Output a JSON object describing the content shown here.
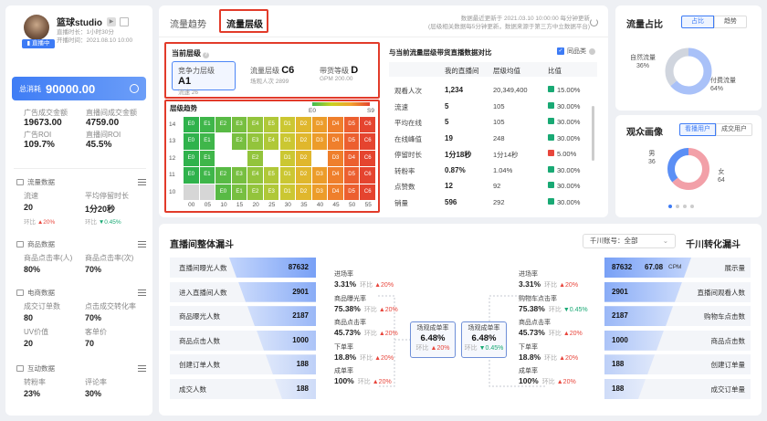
{
  "profile": {
    "name": "篮球studio",
    "live_badge": "直播中",
    "duration_label": "直播时长：",
    "duration_value": "1小时30分",
    "start_label": "开播时间：",
    "start_value": "2021.08.10 10:00"
  },
  "total": {
    "label": "总消耗",
    "value": "90000.00"
  },
  "metrics": [
    {
      "label": "广告成交金额",
      "value": "19673.00"
    },
    {
      "label": "直播间成交金额",
      "value": "4759.00"
    },
    {
      "label": "广告ROI",
      "value": "109.7%"
    },
    {
      "label": "直播间ROI",
      "value": "45.5%"
    }
  ],
  "sections": [
    {
      "title": "流量数据",
      "items": [
        {
          "label": "流速",
          "value": "20",
          "trend": "环比",
          "change": "20%",
          "dir": "up"
        },
        {
          "label": "平均停留时长",
          "value": "1分20秒",
          "trend": "环比",
          "change": "0.45%",
          "dir": "down"
        }
      ]
    },
    {
      "title": "商品数据",
      "items": [
        {
          "label": "商品点击率(人)",
          "value": "80%"
        },
        {
          "label": "商品点击率(次)",
          "value": "70%"
        }
      ]
    },
    {
      "title": "电商数据",
      "items": [
        {
          "label": "成交订单数",
          "value": "80"
        },
        {
          "label": "点击成交转化率",
          "value": "70%"
        },
        {
          "label": "UV价值",
          "value": "20"
        },
        {
          "label": "客单价",
          "value": "70"
        }
      ]
    },
    {
      "title": "互动数据",
      "items": [
        {
          "label": "转粉率",
          "value": "23%"
        },
        {
          "label": "评论率",
          "value": "30%"
        }
      ]
    }
  ],
  "tabs": [
    "流量趋势",
    "流量层级"
  ],
  "update": {
    "line1": "数据最近更新于 2021.03.10 10:00:00  每分钟更新",
    "line2": "(层级相关数据每5分钟更新，数据来源于第三方中立数据平台)"
  },
  "current_level": {
    "title": "当前层级",
    "items": [
      {
        "label": "竞争力层级",
        "value": "A1",
        "sub": "流速 26"
      },
      {
        "label": "流量层级",
        "value": "C6",
        "sub": "场观人次 2899"
      },
      {
        "label": "带货等级",
        "value": "D",
        "sub": "GPM 200.00"
      }
    ]
  },
  "level_trend": {
    "title": "层级趋势",
    "scale_min": "E0",
    "scale_max": "S9",
    "y": [
      "14",
      "13",
      "12",
      "11",
      "10"
    ],
    "x": [
      "00",
      "05",
      "10",
      "15",
      "20",
      "25",
      "30",
      "35",
      "40",
      "45",
      "50",
      "55"
    ],
    "rows": [
      [
        "E0",
        "E1",
        "E2",
        "E3",
        "E4",
        "E5",
        "D1",
        "D2",
        "D3",
        "D4",
        "D5",
        "C6"
      ],
      [
        "E0",
        "E1",
        "",
        "E2",
        "E3",
        "E4",
        "D1",
        "D2",
        "D3",
        "D4",
        "D5",
        "C6"
      ],
      [
        "E0",
        "E1",
        "",
        "",
        "E2",
        "",
        "D1",
        "D2",
        "",
        "D3",
        "D4",
        "C6"
      ],
      [
        "E0",
        "E1",
        "E2",
        "E3",
        "E4",
        "E5",
        "D1",
        "D2",
        "D3",
        "D4",
        "D5",
        "C6"
      ],
      [
        "",
        "",
        "E0",
        "E1",
        "E2",
        "E3",
        "D1",
        "D2",
        "D3",
        "D4",
        "D5",
        "C6"
      ]
    ]
  },
  "compare": {
    "title": "与当前流量层级带货直播数据对比",
    "filter": "同品类",
    "headers": [
      "",
      "我的直播间",
      "层级均值",
      "比值"
    ],
    "rows": [
      {
        "label": "观看人次",
        "mine": "1,234",
        "avg": "20,349,400",
        "ratio": "15.00%",
        "dir": "up"
      },
      {
        "label": "流速",
        "mine": "5",
        "avg": "105",
        "ratio": "30.00%",
        "dir": "up"
      },
      {
        "label": "平均在线",
        "mine": "5",
        "avg": "105",
        "ratio": "30.00%",
        "dir": "up"
      },
      {
        "label": "在线峰值",
        "mine": "19",
        "avg": "248",
        "ratio": "30.00%",
        "dir": "up"
      },
      {
        "label": "停留时长",
        "mine": "1分18秒",
        "avg": "1分14秒",
        "ratio": "5.00%",
        "dir": "down"
      },
      {
        "label": "转粉率",
        "mine": "0.87%",
        "avg": "1.04%",
        "ratio": "30.00%",
        "dir": "up"
      },
      {
        "label": "点赞数",
        "mine": "12",
        "avg": "92",
        "ratio": "30.00%",
        "dir": "up"
      },
      {
        "label": "销量",
        "mine": "596",
        "avg": "292",
        "ratio": "30.00%",
        "dir": "up"
      }
    ]
  },
  "traffic_share": {
    "title": "流量占比",
    "tabs": [
      "占比",
      "趋势"
    ],
    "natural_label": "自然流量",
    "natural_value": "36%",
    "paid_label": "付费流量",
    "paid_value": "64%",
    "natural": 36,
    "paid": 64
  },
  "audience": {
    "title": "观众画像",
    "tabs": [
      "看播用户",
      "成交用户"
    ],
    "male_label": "男",
    "male_value": "36",
    "female_label": "女",
    "female_value": "64",
    "male": 36,
    "female": 64
  },
  "funnel": {
    "title": "直播间整体漏斗",
    "select_label": "千川账号：全部",
    "right_title": "千川转化漏斗",
    "left": [
      {
        "label": "直播间曝光人数",
        "value": "87632"
      },
      {
        "label": "进入直播间人数",
        "value": "2901"
      },
      {
        "label": "商品曝光人数",
        "value": "2187"
      },
      {
        "label": "商品点击人数",
        "value": "1000"
      },
      {
        "label": "创建订单人数",
        "value": "188"
      },
      {
        "label": "成交人数",
        "value": "188"
      }
    ],
    "left_rates": [
      {
        "label": "进场率",
        "value": "3.31%",
        "trend": "环比",
        "change": "20%",
        "dir": "up"
      },
      {
        "label": "商品曝光率",
        "value": "75.38%",
        "trend": "环比",
        "change": "20%",
        "dir": "up"
      },
      {
        "label": "商品点击率",
        "value": "45.73%",
        "trend": "环比",
        "change": "20%",
        "dir": "up"
      },
      {
        "label": "下单率",
        "value": "18.8%",
        "trend": "环比",
        "change": "20%",
        "dir": "up"
      },
      {
        "label": "成单率",
        "value": "100%",
        "trend": "环比",
        "change": "20%",
        "dir": "up"
      }
    ],
    "mid": [
      {
        "label": "场观成单率",
        "value": "6.48%",
        "trend": "环比",
        "change": "20%",
        "dir": "up"
      },
      {
        "label": "场观成单率",
        "value": "6.48%",
        "trend": "环比",
        "change": "0.45%",
        "dir": "down"
      }
    ],
    "right_rates": [
      {
        "label": "进场率",
        "value": "3.31%",
        "trend": "环比",
        "change": "20%",
        "dir": "up"
      },
      {
        "label": "购物车点击率",
        "value": "75.38%",
        "trend": "环比",
        "change": "0.45%",
        "dir": "down"
      },
      {
        "label": "商品点击率",
        "value": "45.73%",
        "trend": "环比",
        "change": "20%",
        "dir": "up"
      },
      {
        "label": "下单率",
        "value": "18.8%",
        "trend": "环比",
        "change": "20%",
        "dir": "up"
      },
      {
        "label": "成单率",
        "value": "100%",
        "trend": "环比",
        "change": "20%",
        "dir": "up"
      }
    ],
    "right": [
      {
        "label": "展示量",
        "value": "87632",
        "extra": "67.08",
        "extra_unit": "CPM"
      },
      {
        "label": "直播间观看人数",
        "value": "2901"
      },
      {
        "label": "购物车点击数",
        "value": "2187"
      },
      {
        "label": "商品点击数",
        "value": "1000"
      },
      {
        "label": "创建订单量",
        "value": "188"
      },
      {
        "label": "成交订单量",
        "value": "188"
      }
    ]
  },
  "colors": {
    "accent": "#3d7bf5",
    "up": "#e8463c",
    "down": "#19a974",
    "highlight": "#e23b2a"
  }
}
